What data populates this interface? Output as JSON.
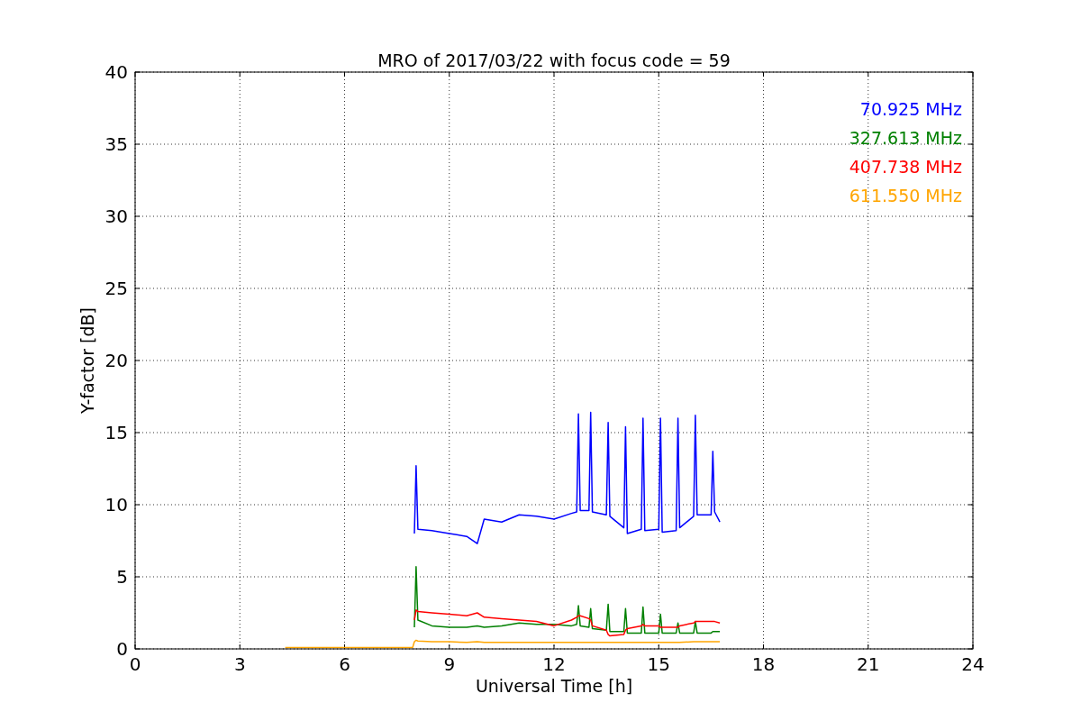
{
  "figure": {
    "chart_data": {
      "type": "line",
      "title": "MRO of 2017/03/22 with focus code = 59",
      "xlabel": "Universal Time [h]",
      "ylabel": "Y-factor [dB]",
      "x": [
        4.3,
        6,
        7.95,
        8.0,
        8.05,
        8.1,
        8.5,
        9,
        9.5,
        9.8,
        10,
        10.5,
        11,
        11.5,
        12,
        12.5,
        12.65,
        12.7,
        12.75,
        13,
        13.05,
        13.1,
        13.5,
        13.55,
        13.6,
        14,
        14.05,
        14.1,
        14.5,
        14.55,
        14.6,
        15,
        15.05,
        15.1,
        15.5,
        15.55,
        15.6,
        16,
        16.05,
        16.1,
        16.5,
        16.55,
        16.6,
        16.75
      ],
      "grid": true,
      "xlim": [
        0,
        24
      ],
      "ylim": [
        0,
        40
      ],
      "xticks": [
        0,
        3,
        6,
        9,
        12,
        15,
        18,
        21,
        24
      ],
      "yticks": [
        0,
        5,
        10,
        15,
        20,
        25,
        30,
        35,
        40
      ],
      "series": [
        {
          "name": "70.925 MHz",
          "color": "#0000ff",
          "values": [
            null,
            null,
            null,
            8.0,
            12.7,
            8.3,
            8.2,
            8.0,
            7.8,
            7.3,
            9.0,
            8.8,
            9.3,
            9.2,
            9.0,
            9.4,
            9.5,
            16.3,
            9.6,
            9.6,
            16.4,
            9.5,
            9.3,
            15.7,
            9.2,
            8.4,
            15.4,
            8.0,
            8.3,
            16.0,
            8.2,
            8.3,
            16.0,
            8.1,
            8.2,
            16.0,
            8.4,
            9.2,
            16.2,
            9.3,
            9.3,
            13.7,
            9.5,
            8.8
          ]
        },
        {
          "name": "327.613 MHz",
          "color": "#008000",
          "values": [
            null,
            null,
            null,
            1.5,
            5.7,
            2.0,
            1.6,
            1.5,
            1.5,
            1.6,
            1.5,
            1.6,
            1.8,
            1.7,
            1.7,
            1.6,
            1.7,
            3.0,
            1.6,
            1.5,
            2.8,
            1.4,
            1.3,
            3.1,
            1.2,
            1.2,
            2.8,
            1.1,
            1.1,
            2.9,
            1.1,
            1.1,
            2.4,
            1.1,
            1.1,
            1.8,
            1.1,
            1.1,
            1.9,
            1.1,
            1.1,
            1.2,
            1.2,
            1.2
          ]
        },
        {
          "name": "407.738 MHz",
          "color": "#ff0000",
          "values": [
            null,
            null,
            null,
            2.0,
            2.7,
            2.6,
            2.5,
            2.4,
            2.3,
            2.5,
            2.2,
            2.1,
            2.0,
            1.9,
            1.6,
            2.0,
            2.2,
            2.3,
            2.3,
            2.1,
            2.0,
            1.6,
            1.3,
            1.0,
            0.9,
            1.0,
            1.3,
            1.4,
            1.6,
            1.7,
            1.6,
            1.6,
            1.5,
            1.5,
            1.5,
            1.5,
            1.6,
            1.8,
            1.9,
            1.9,
            1.9,
            1.9,
            1.9,
            1.8
          ]
        },
        {
          "name": "611.550 MHz",
          "color": "#ffa500",
          "values": [
            0.1,
            0.1,
            0.1,
            0.5,
            0.6,
            0.55,
            0.5,
            0.5,
            0.45,
            0.5,
            0.45,
            0.45,
            0.45,
            0.45,
            0.45,
            0.45,
            0.45,
            0.45,
            0.45,
            0.45,
            0.45,
            0.45,
            0.45,
            0.45,
            0.45,
            0.45,
            0.45,
            0.45,
            0.45,
            0.45,
            0.45,
            0.45,
            0.45,
            0.45,
            0.45,
            0.45,
            0.45,
            0.5,
            0.5,
            0.5,
            0.5,
            0.5,
            0.5,
            0.5
          ]
        }
      ]
    }
  }
}
